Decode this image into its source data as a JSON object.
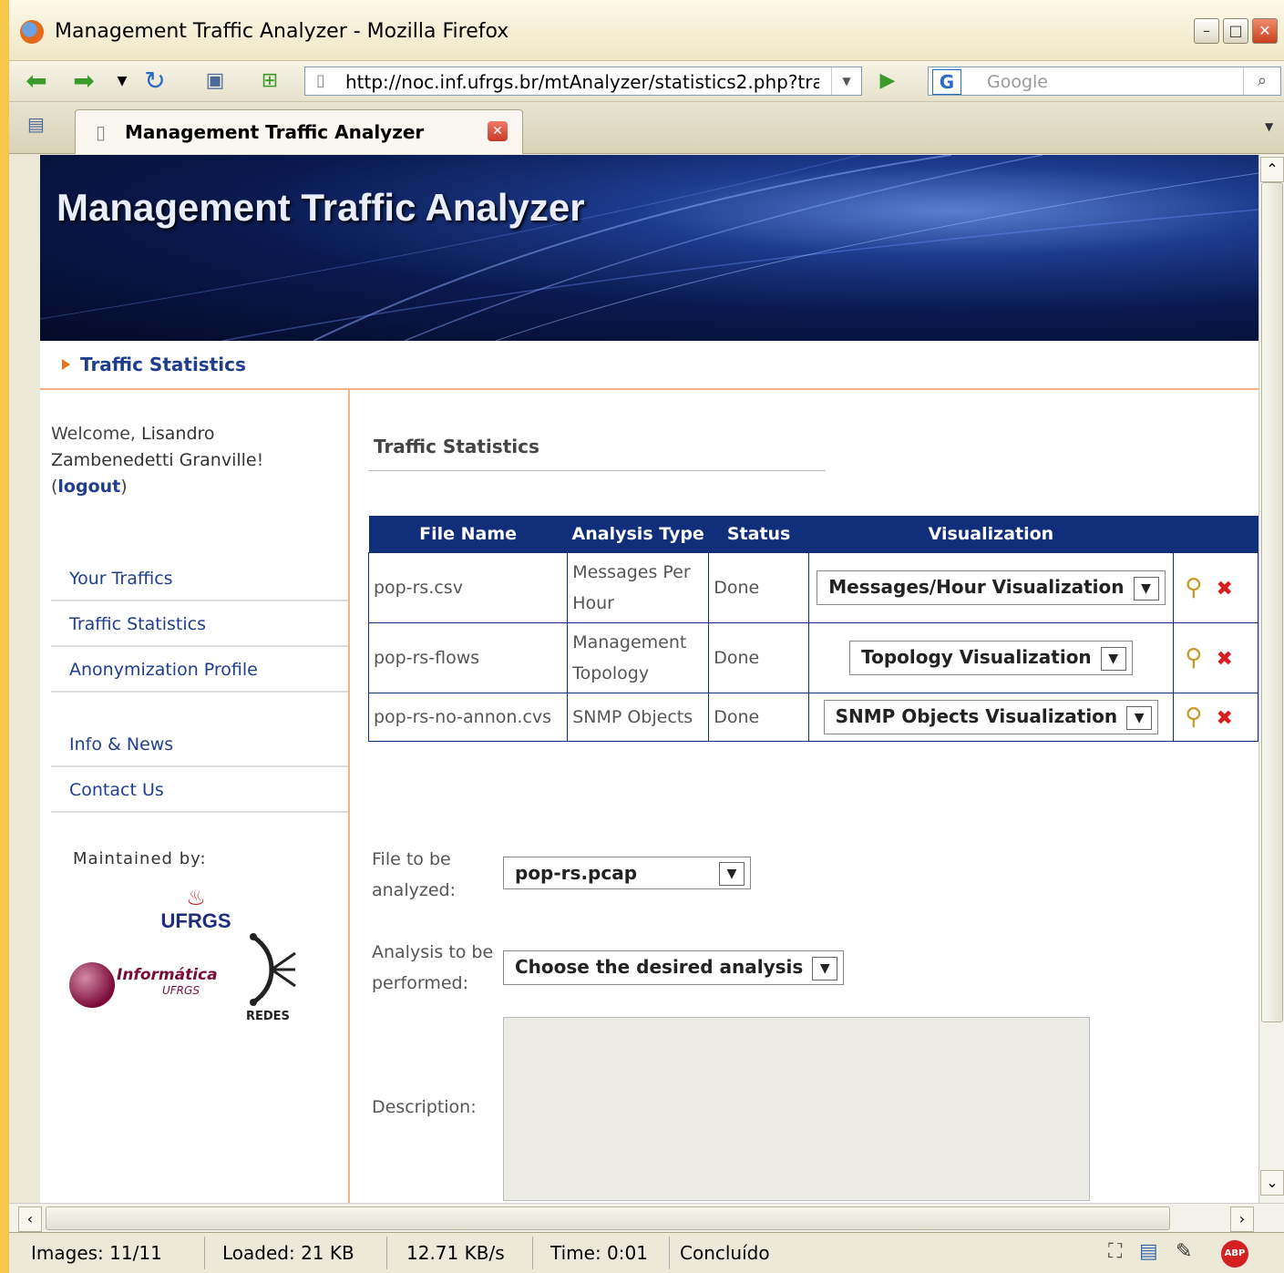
{
  "window": {
    "title": "Management Traffic Analyzer - Mozilla Firefox"
  },
  "navbar": {
    "url": "http://noc.inf.ufrgs.br/mtAnalyzer/statistics2.php?traf",
    "search_placeholder": "Google"
  },
  "tab": {
    "label": "Management Traffic Analyzer"
  },
  "banner": {
    "title": "Management Traffic Analyzer"
  },
  "breadcrumb": {
    "label": "Traffic Statistics"
  },
  "sidebar": {
    "welcome_prefix": "Welcome, ",
    "user_name": "Lisandro Zambenedetti Granville",
    "welcome_suffix": "!",
    "logout": "logout",
    "menu": [
      "Your Traffics",
      "Traffic Statistics",
      "Anonymization Profile",
      "Info & News",
      "Contact Us"
    ],
    "maintained_by": "Maintained by:",
    "logos": {
      "ufrgs": "UFRGS",
      "informatica": "Informática",
      "informatica_sub": "UFRGS",
      "redes": "REDES"
    }
  },
  "main": {
    "heading": "Traffic Statistics",
    "table": {
      "headers": [
        "File Name",
        "Analysis Type",
        "Status",
        "Visualization"
      ],
      "rows": [
        {
          "file": "pop-rs.csv",
          "type": "Messages Per Hour",
          "status": "Done",
          "visualization": "Messages/Hour Visualization"
        },
        {
          "file": "pop-rs-flows",
          "type": "Management Topology",
          "status": "Done",
          "visualization": "Topology Visualization"
        },
        {
          "file": "pop-rs-no-annon.cvs",
          "type": "SNMP Objects",
          "status": "Done",
          "visualization": "SNMP Objects Visualization"
        }
      ]
    },
    "form": {
      "file_label": "File to be analyzed:",
      "file_value": "pop-rs.pcap",
      "analysis_label": "Analysis to be performed:",
      "analysis_value": "Choose the desired analysis",
      "description_label": "Description:"
    }
  },
  "status": {
    "images": "Images: 11/11",
    "loaded": "Loaded: 21 KB",
    "speed": "12.71 KB/s",
    "time": "Time: 0:01",
    "message": "Concluído",
    "abp": "ABP"
  }
}
